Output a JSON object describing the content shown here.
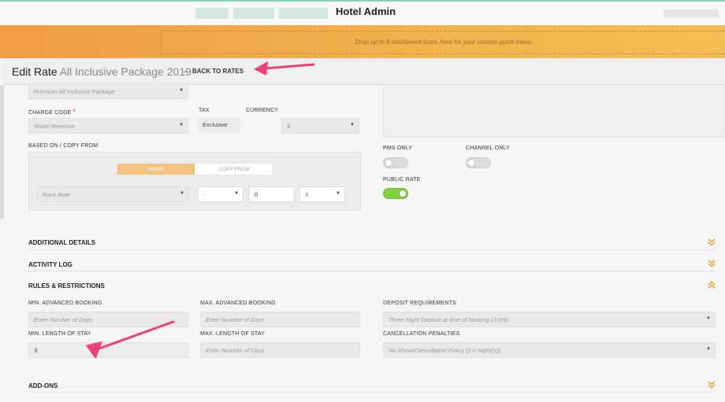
{
  "header": {
    "app_title": "Hotel Admin"
  },
  "quick_menu": {
    "hint": "Drop up to 8 dashboard icons here for your custom quick menu"
  },
  "page": {
    "title": "Edit Rate",
    "subtitle": "All Inclusive Package 2019",
    "back_label": "BACK TO RATES"
  },
  "form": {
    "package_select": "Premium All Inclusive Package",
    "charge_code_label": "CHARGE CODE",
    "charge_code_value": "Room Revenue",
    "tax_label": "TAX",
    "tax_value": "Exclusive",
    "currency_label": "CURRENCY",
    "currency_value": "$",
    "based_on_label": "BASED ON / COPY FROM",
    "tabs": {
      "based": "BASED",
      "copy_from": "COPY FROM"
    },
    "rack_rate": "Rack Rate",
    "operator": "-",
    "amount": "0",
    "amount_unit": "$",
    "pms_only_label": "PMS ONLY",
    "channel_only_label": "CHANNEL ONLY",
    "public_rate_label": "PUBLIC RATE",
    "toggles": {
      "pms_only": false,
      "channel_only": false,
      "public_rate": true
    }
  },
  "sections": {
    "additional_details": "ADDITIONAL DETAILS",
    "activity_log": "ACTIVITY LOG",
    "rules": "RULES & RESTRICTIONS",
    "addons": "ADD-ONS"
  },
  "rules": {
    "min_adv_label": "MIN. ADVANCED BOOKING",
    "min_adv_placeholder": "Enter Number of Days",
    "max_adv_label": "MAX. ADVANCED BOOKING",
    "max_adv_placeholder": "Enter Number of Days",
    "deposit_label": "DEPOSIT REQUIREMENTS",
    "deposit_value": "Three Night Deposit at time of booking (3.0%)",
    "min_los_label": "MIN. LENGTH OF STAY",
    "min_los_value": "3",
    "max_los_label": "MAX. LENGTH OF STAY",
    "max_los_placeholder": "Enter Number of Days",
    "cancel_label": "CANCELLATION PENALTIES",
    "cancel_value": "No Show/Cancellation Policy (3.0 Night(s))"
  },
  "colors": {
    "accent_orange": "#f2b34d",
    "toggle_on": "#7ed03c",
    "annotation_arrow": "#ee3f78"
  }
}
